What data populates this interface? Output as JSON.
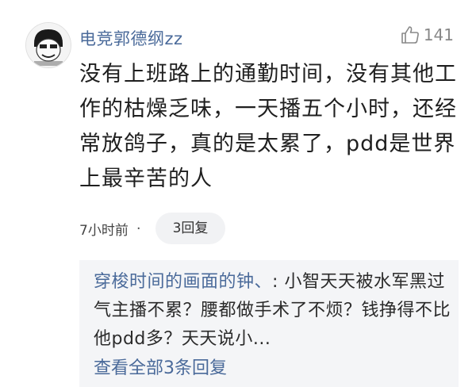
{
  "comment": {
    "username": "电竞郭德纲zz",
    "like_count": "141",
    "like_icon": "thumb-up-icon",
    "text": "没有上班路上的通勤时间，没有其他工作的枯燥乏味，一天播五个小时，还经常放鸽子，真的是太累了，pdd是世界上最辛苦的人",
    "time": "7小时前",
    "separator": "·",
    "reply_count_label": "3回复"
  },
  "reply_preview": {
    "author": "穿梭时间的画面的钟、",
    "separator": ":",
    "text": "小智天天被水军黑过气主播不累？腰都做手术了不烦？钱挣得不比他pdd多？天天说小...",
    "more_label": "查看全部3条回复"
  },
  "colors": {
    "username": "#4a6a9a",
    "reply_bg": "#f4f5f7",
    "button_bg": "#f1f2f4"
  }
}
